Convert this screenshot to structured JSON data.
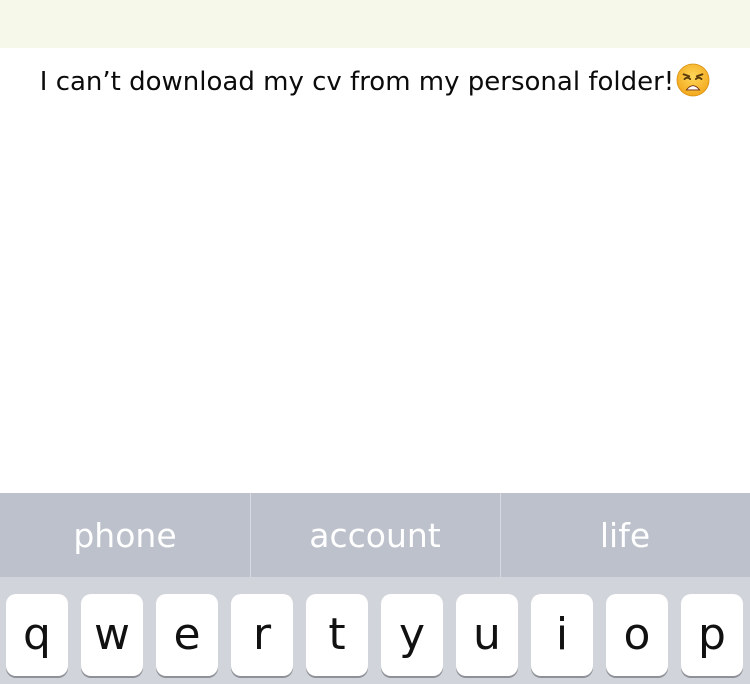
{
  "message": {
    "text": "I can’t download my cv from my personal folder!",
    "emoji": "weary-face-emoji"
  },
  "suggestions": [
    "phone",
    "account",
    "life"
  ],
  "keyboard": {
    "row1": [
      "q",
      "w",
      "e",
      "r",
      "t",
      "y",
      "u",
      "i",
      "o",
      "p"
    ]
  },
  "colors": {
    "top_bar": "#f6f8e9",
    "suggestion_bar": "#bcc1cb",
    "keyboard_bg": "#d1d4da",
    "key_bg": "#ffffff"
  }
}
